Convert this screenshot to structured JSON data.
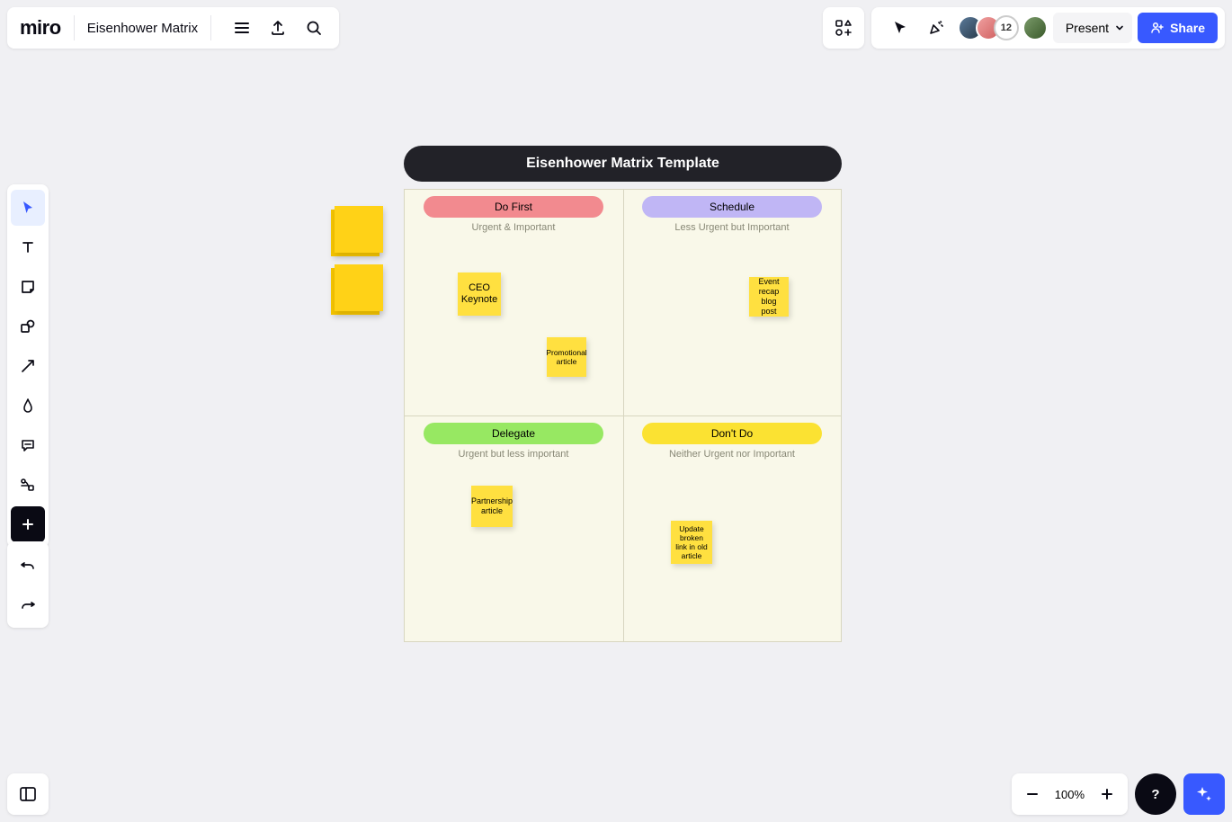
{
  "app": {
    "logo": "miro",
    "board_title": "Eisenhower Matrix"
  },
  "header": {
    "user_count": "12",
    "present_label": "Present",
    "share_label": "Share"
  },
  "canvas": {
    "title": "Eisenhower Matrix Template",
    "quadrants": {
      "q1": {
        "label": "Do First",
        "sub": "Urgent & Important"
      },
      "q2": {
        "label": "Schedule",
        "sub": "Less Urgent but Important"
      },
      "q3": {
        "label": "Delegate",
        "sub": "Urgent but less important"
      },
      "q4": {
        "label": "Don't Do",
        "sub": "Neither Urgent nor Important"
      }
    },
    "stickies": {
      "ceo": "CEO Keynote",
      "promo": "Promotional article",
      "event": "Event recap blog post",
      "partner": "Partnership article",
      "broken": "Update broken link in old article"
    }
  },
  "zoom": {
    "level": "100%"
  },
  "help": {
    "label": "?"
  },
  "colors": {
    "accent": "#3859ff",
    "q1": "#f28a8f",
    "q2": "#c0b6f5",
    "q3": "#97e862",
    "q4": "#fbe232",
    "sticky": "#ffe040"
  }
}
